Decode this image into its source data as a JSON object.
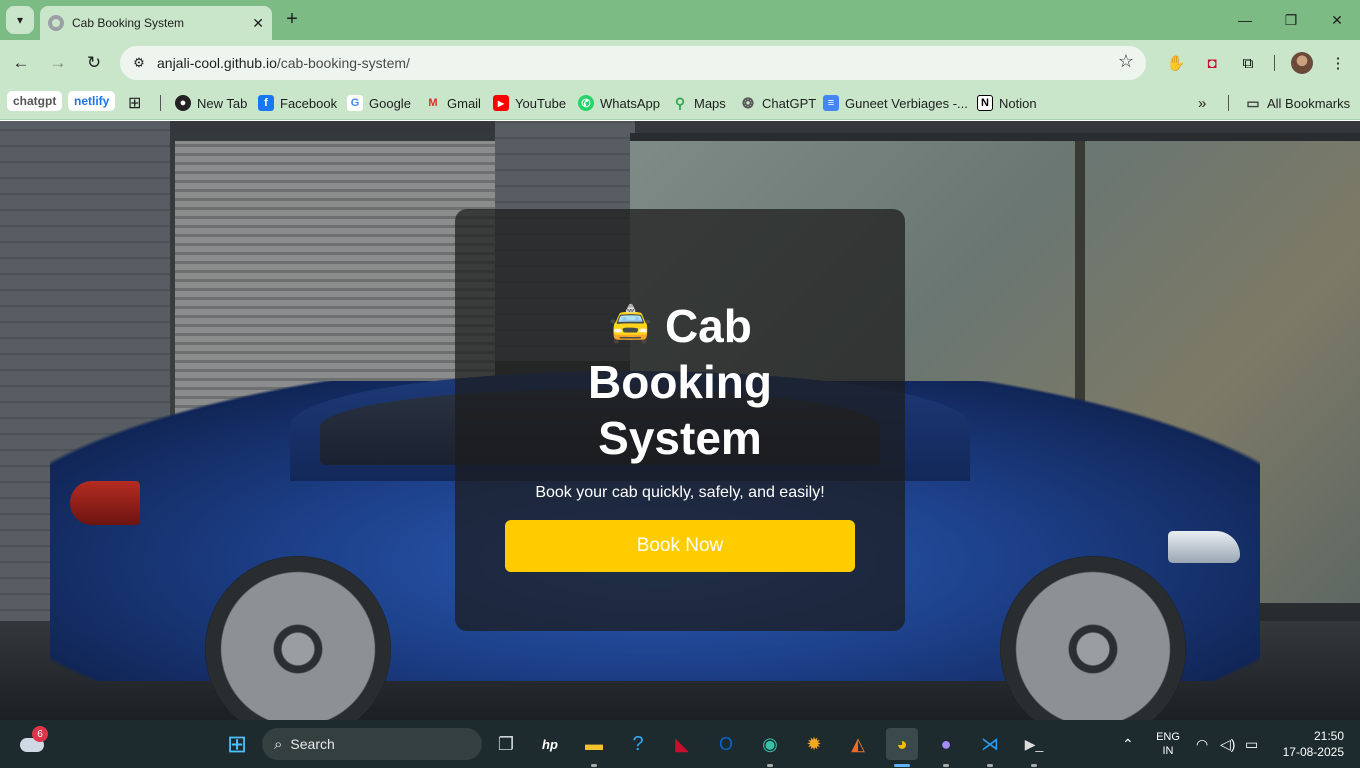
{
  "browser": {
    "tab_title": "Cab Booking System",
    "url_host": "anjali-cool.github.io",
    "url_path": "/cab-booking-system/"
  },
  "bookmarks": {
    "chips": [
      "chatgpt",
      "netlify"
    ],
    "items": [
      {
        "label": "New Tab",
        "icon": "globe-icon"
      },
      {
        "label": "Facebook",
        "icon": "facebook-icon"
      },
      {
        "label": "Google",
        "icon": "google-icon"
      },
      {
        "label": "Gmail",
        "icon": "gmail-icon"
      },
      {
        "label": "YouTube",
        "icon": "youtube-icon"
      },
      {
        "label": "WhatsApp",
        "icon": "whatsapp-icon"
      },
      {
        "label": "Maps",
        "icon": "maps-icon"
      },
      {
        "label": "ChatGPT",
        "icon": "chatgpt-icon"
      },
      {
        "label": "Guneet Verbiages -...",
        "icon": "docs-icon"
      },
      {
        "label": "Notion",
        "icon": "notion-icon"
      }
    ],
    "all_bookmarks": "All Bookmarks"
  },
  "hero": {
    "title_line1": "Cab",
    "title_line2": "Booking",
    "title_line3": "System",
    "subtitle": "Book your cab quickly, safely, and easily!",
    "cta_label": "Book Now",
    "cta_color": "#ffcc00"
  },
  "taskbar": {
    "search_placeholder": "Search",
    "weather_badge": "6",
    "lang_line1": "ENG",
    "lang_line2": "IN",
    "time": "21:50",
    "date": "17-08-2025"
  },
  "colors": {
    "chrome_frame": "#7dbb85",
    "chrome_toolbar": "#c9e6cb",
    "taskbar": "#1d2b2e"
  }
}
